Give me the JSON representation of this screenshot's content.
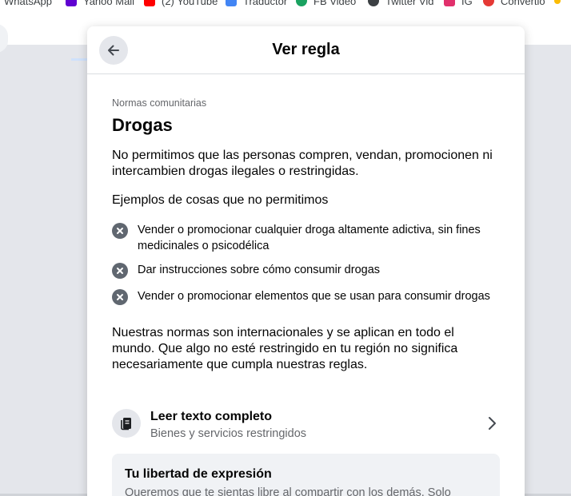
{
  "bookmarks": [
    {
      "label": "WhatsApp",
      "icon": "whatsapp-icon",
      "color": "#25d366"
    },
    {
      "label": "Yahoo Mail",
      "icon": "yahoo-mail-icon",
      "color": "#5f01d1"
    },
    {
      "label": "(2) YouTube",
      "icon": "youtube-icon",
      "color": "#ff0000"
    },
    {
      "label": "Traductor",
      "icon": "translate-icon",
      "color": "#4285f4"
    },
    {
      "label": "FB Video",
      "icon": "fb-video-icon",
      "color": "#1aa260"
    },
    {
      "label": "Twitter Vid",
      "icon": "twitter-vid-icon",
      "color": "#3c4043"
    },
    {
      "label": "IG",
      "icon": "instagram-icon",
      "color": "#e1306c"
    },
    {
      "label": "Convertio",
      "icon": "convertio-icon",
      "color": "#e53935"
    }
  ],
  "modal": {
    "title": "Ver regla",
    "back_icon": "arrow-left-icon",
    "eyebrow": "Normas comunitarias",
    "heading": "Drogas",
    "intro": "No permitimos que las personas compren, vendan, promocionen ni intercambien drogas ilegales o restringidas.",
    "examples_title": "Ejemplos de cosas que no permitimos",
    "examples": [
      "Vender o promocionar cualquier droga altamente adictiva, sin fines medicinales o psicodélica",
      "Dar instrucciones sobre cómo consumir drogas",
      "Vender o promocionar elementos que se usan para consumir drogas"
    ],
    "outro": "Nuestras normas son internacionales y se aplican en todo el mundo. Que algo no esté restringido en tu región no significa necesariamente que cumpla nuestras reglas.",
    "link": {
      "title": "Leer texto completo",
      "subtitle": "Bienes y servicios restringidos",
      "icon": "document-icon",
      "chevron": "chevron-right-icon"
    },
    "freedom": {
      "title": "Tu libertad de expresión",
      "text": "Queremos que te sientas libre al compartir con los demás. Solo"
    }
  },
  "colors": {
    "icon_gray": "#606770",
    "secondary_text": "#65676b",
    "page_bg": "#e4e6eb"
  }
}
